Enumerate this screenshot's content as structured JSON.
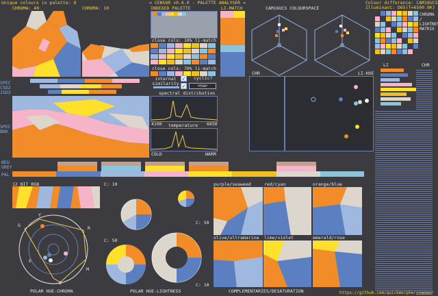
{
  "header": {
    "unique_colours": "Unique colours in palette: 8",
    "title": "= CENSOR v0.6.0 - PALETTE ANALYSER =",
    "colour_diff": "Colour difference: CAM16UCS",
    "illuminant": "Illuminant: D65(T=6500.0K)",
    "github": "https://github.com/quickmorpher/censor"
  },
  "labels": {
    "chroma_40": "CHROMA: 40",
    "chroma_10": "CHROMA: 10",
    "indexed_palette": "INDEXED PALETTE",
    "li_match": "LI-MATCH",
    "cam16ucs": "CAM16UCS COLOURSPACE",
    "close_cols_10": "close cols: 10% li-match",
    "close_cols_70": "close cols: 70% li-match",
    "internal_similarity": "internal similarity",
    "cyclic": "cyclic?",
    "na": "<na>",
    "spectral": "spectral distribution",
    "spec_lo": "4100",
    "spec_hi": "6650",
    "temperature": "temperature",
    "cold": "COLD",
    "warm": "WARM",
    "chr": "CHR",
    "li_hue": "LI-HUE",
    "li": "LI",
    "chr2": "CHR",
    "spec": "SPEC",
    "csd2": "CSD2",
    "jsd2": "JSD2",
    "spec_bdk": "SPEC BDK",
    "neu": "NEU",
    "grey": "GREY",
    "pal": "PAL",
    "bit12": "12 BIT RGB",
    "c10a": "C: 10",
    "c50a": "C: 50",
    "c50b": "C: 50",
    "c10b": "C: 10",
    "purple_seaweed": "purple/seaweed",
    "red_cyan": "red/cyan",
    "orange_blue": "orange/blue",
    "olive_ultramarine": "olive/ultramarine",
    "lime_violet": "lime/violet",
    "emerald_rose": "emerald/rose",
    "polar_hue_chroma": "POLAR HUE-CHROMA",
    "polar_hue_lightness": "POLAR HUE-LIGHTNESS",
    "complementaries": "COMPLEMENTARIES/DESATURATION",
    "side_text": "CHROMA / LIGHTNESS MATRIX",
    "wheel_g": "G",
    "wheel_y": "Y",
    "wheel_r": "R",
    "wheel_e": "E",
    "wheel_m": "M",
    "wheel_b": "B"
  },
  "palette": [
    "#f28c28",
    "#5b7fc1",
    "#9fb8e0",
    "#f5b4c8",
    "#ffe02a",
    "#f0c020",
    "#dcd6cc",
    "#8cc4dc"
  ],
  "colors": {
    "bg": "#3b3b40",
    "accent": "#f0d050",
    "frame": "#6a7fb0",
    "text_blue": "#8fb0e0"
  }
}
